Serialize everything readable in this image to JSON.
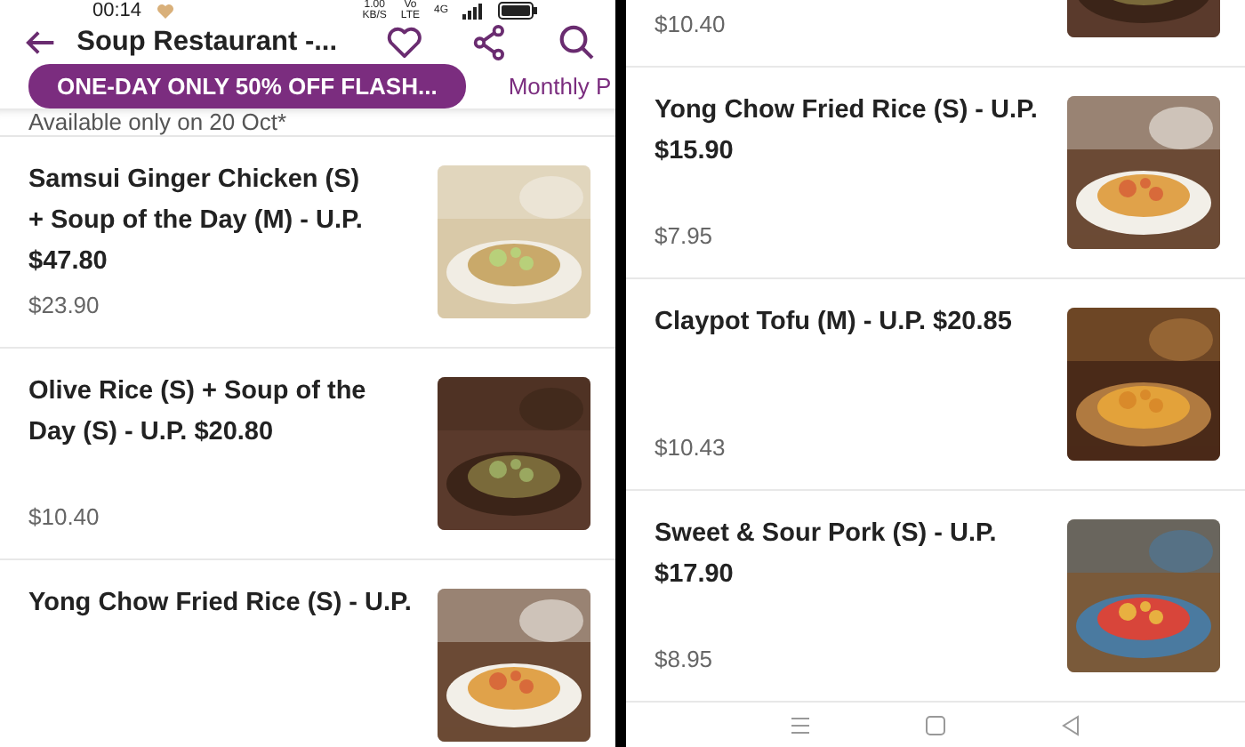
{
  "left_screen": {
    "status_bar": {
      "time": "00:14",
      "speed": [
        "1.00",
        "KB/S"
      ],
      "network": [
        "Vo",
        "LTE"
      ],
      "signal_label": "4G"
    },
    "header": {
      "title": "Soup Restaurant -..."
    },
    "promo_tabs": [
      {
        "label": "ONE-DAY ONLY 50% OFF FLASH...",
        "selected": true
      },
      {
        "label": "Monthly P",
        "selected": false
      }
    ],
    "availability_note": "Available only on 20 Oct*",
    "items": [
      {
        "kind": "full",
        "title": "Samsui Ginger Chicken (S)\n+ Soup of the Day (M) - U.P.\n$47.80",
        "price": "$23.90"
      },
      {
        "kind": "full",
        "title": "Olive Rice (S) + Soup of the\nDay (S) - U.P. $20.80",
        "price": "$10.40"
      },
      {
        "kind": "head",
        "title": "Yong Chow Fried Rice (S) - U.P."
      }
    ]
  },
  "right_screen": {
    "items": [
      {
        "kind": "tail",
        "price": "$10.40"
      },
      {
        "kind": "full",
        "title": "Yong Chow Fried Rice (S) - U.P.\n$15.90",
        "price": "$7.95"
      },
      {
        "kind": "full",
        "title": "Claypot Tofu (M) - U.P. $20.85",
        "price": "$10.43"
      },
      {
        "kind": "full",
        "title": "Sweet & Sour Pork (S) - U.P.\n$17.90",
        "price": "$8.95"
      }
    ]
  }
}
